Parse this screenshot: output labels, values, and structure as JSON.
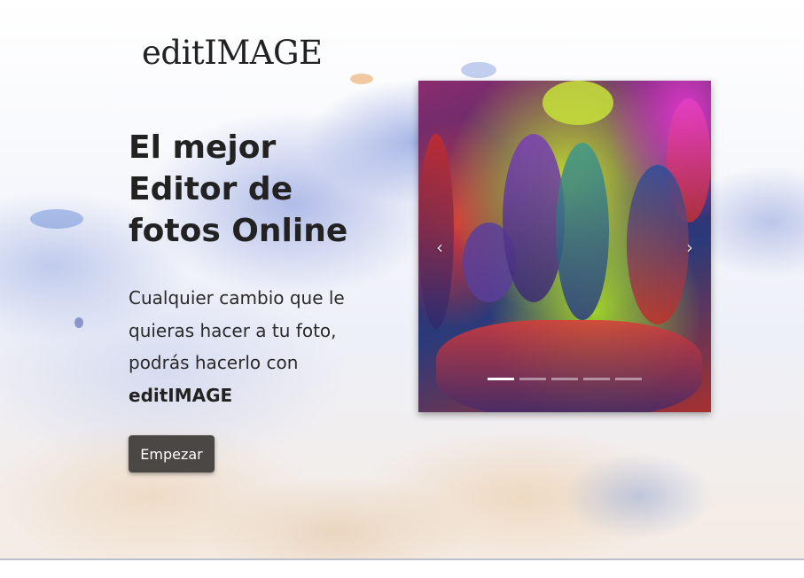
{
  "brand": {
    "logo_text": "editIMAGE"
  },
  "hero": {
    "title": "El mejor Editor de fotos Online",
    "description_text": "Cualquier cambio que le quieras hacer a tu foto, podrás hacerlo con",
    "description_strong": "editIMAGE",
    "start_button_label": "Empezar"
  },
  "carousel": {
    "prev_icon": "‹",
    "next_icon": "›",
    "slide_count": 5,
    "active_slide": 1,
    "image_description_icon": "colorful-festival-photo"
  },
  "colors": {
    "button_bg": "#4a4745",
    "button_text": "#ffffff",
    "text": "#222222",
    "indicator_active": "#ffffff"
  }
}
